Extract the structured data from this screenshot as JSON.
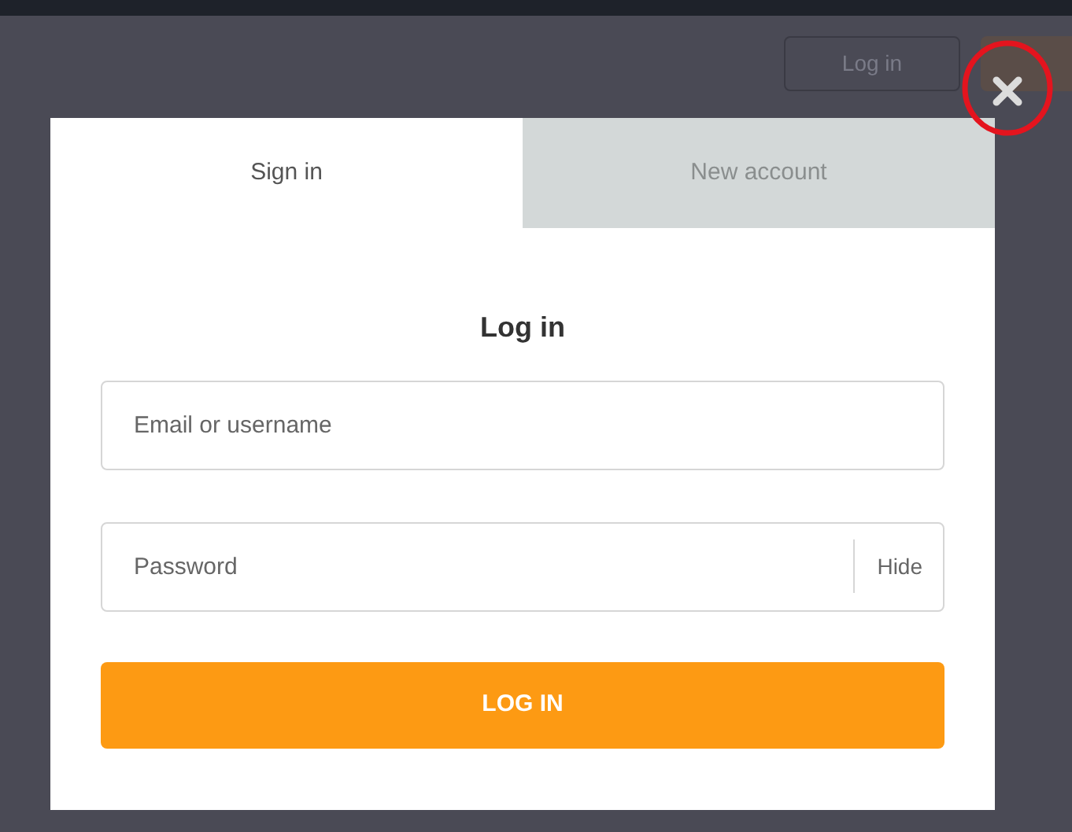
{
  "background": {
    "login_button": "Log in"
  },
  "tabs": [
    {
      "label": "Sign in",
      "selected": true
    },
    {
      "label": "New account",
      "selected": false
    }
  ],
  "title": "Log in",
  "fields": [
    {
      "placeholder": "Email or username"
    },
    {
      "placeholder": "Password",
      "toggle": "Hide"
    }
  ],
  "submit": "LOG IN"
}
